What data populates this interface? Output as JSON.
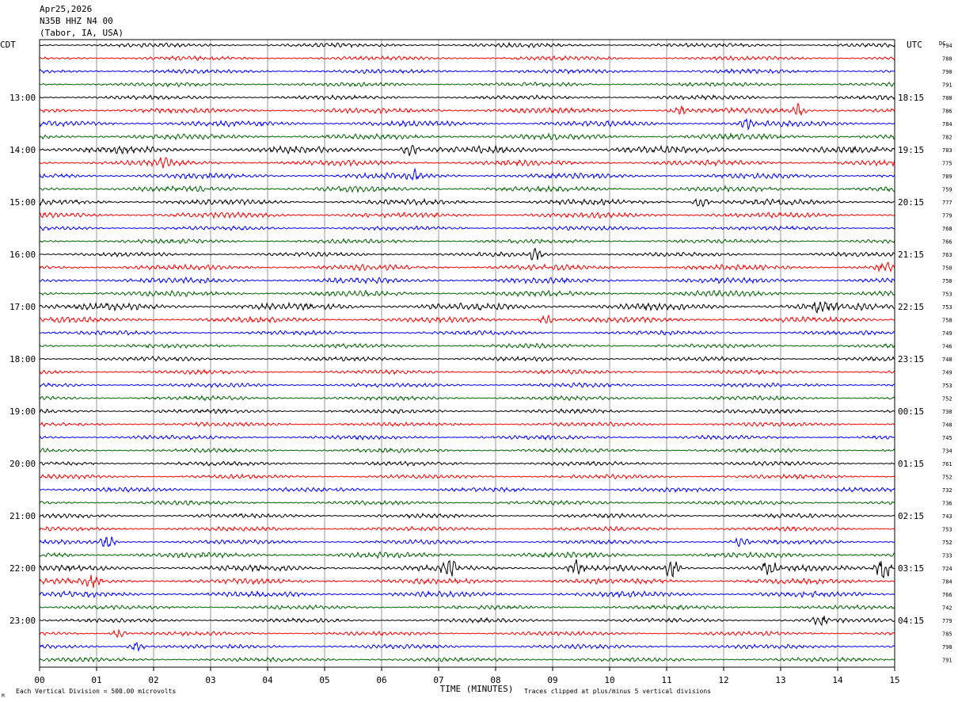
{
  "header": {
    "date": "Apr25,2026",
    "station": "N35B HHZ N4 00",
    "location": "(Tabor, IA, USA)"
  },
  "left_tz_label": "CDT",
  "right_tz_label": "UTC",
  "dc_label": "DC",
  "footer": {
    "xlabel": "TIME (MINUTES)",
    "scale_note": "Each Vertical Division =  500.00 microvolts",
    "clip_note": "Traces clipped at plus/minus 5 vertical divisions",
    "corner_mark": "M"
  },
  "chart_data": {
    "type": "line",
    "title": "N35B HHZ N4 00 (Tabor, IA, USA) Apr25,2026",
    "xlabel": "TIME (MINUTES)",
    "xlim": [
      0,
      15
    ],
    "x_ticks": [
      "00",
      "01",
      "02",
      "03",
      "04",
      "05",
      "06",
      "07",
      "08",
      "09",
      "10",
      "11",
      "12",
      "13",
      "14",
      "15"
    ],
    "trace_colors": [
      "#000000",
      "#ff0000",
      "#0000ff",
      "#006400"
    ],
    "left_time_labels": [
      {
        "trace": 4,
        "label": "13:00"
      },
      {
        "trace": 8,
        "label": "14:00"
      },
      {
        "trace": 12,
        "label": "15:00"
      },
      {
        "trace": 16,
        "label": "16:00"
      },
      {
        "trace": 20,
        "label": "17:00"
      },
      {
        "trace": 24,
        "label": "18:00"
      },
      {
        "trace": 28,
        "label": "19:00"
      },
      {
        "trace": 32,
        "label": "20:00"
      },
      {
        "trace": 36,
        "label": "21:00"
      },
      {
        "trace": 40,
        "label": "22:00"
      },
      {
        "trace": 44,
        "label": "23:00"
      }
    ],
    "right_time_labels": [
      {
        "trace": 4,
        "label": "18:15"
      },
      {
        "trace": 8,
        "label": "19:15"
      },
      {
        "trace": 12,
        "label": "20:15"
      },
      {
        "trace": 16,
        "label": "21:15"
      },
      {
        "trace": 20,
        "label": "22:15"
      },
      {
        "trace": 24,
        "label": "23:15"
      },
      {
        "trace": 28,
        "label": "00:15"
      },
      {
        "trace": 32,
        "label": "01:15"
      },
      {
        "trace": 36,
        "label": "02:15"
      },
      {
        "trace": 40,
        "label": "03:15"
      },
      {
        "trace": 44,
        "label": "04:15"
      }
    ],
    "dc_offsets": [
      794,
      788,
      790,
      791,
      788,
      786,
      784,
      782,
      783,
      775,
      789,
      759,
      777,
      779,
      768,
      766,
      763,
      750,
      750,
      753,
      753,
      758,
      749,
      746,
      748,
      749,
      753,
      752,
      730,
      748,
      745,
      734,
      761,
      752,
      732,
      736,
      743,
      753,
      752,
      733,
      724,
      784,
      766,
      742,
      779,
      785,
      790,
      791
    ],
    "trace_amplitude": [
      3,
      3,
      3,
      3,
      3,
      4,
      4,
      4,
      5,
      4,
      4,
      4,
      4,
      4,
      3,
      3,
      3,
      4,
      4,
      4,
      5,
      4,
      3,
      3,
      3,
      3,
      3,
      3,
      3,
      3,
      3,
      3,
      3,
      3,
      3,
      3,
      3,
      3,
      3,
      4,
      4,
      4,
      4,
      3,
      3,
      3,
      3,
      3
    ],
    "events": [
      {
        "trace": 5,
        "x_min": 11.2,
        "amp": 8
      },
      {
        "trace": 5,
        "x_min": 13.3,
        "amp": 8
      },
      {
        "trace": 6,
        "x_min": 12.4,
        "amp": 8
      },
      {
        "trace": 8,
        "x_min": 6.5,
        "amp": 9
      },
      {
        "trace": 9,
        "x_min": 2.2,
        "amp": 7
      },
      {
        "trace": 10,
        "x_min": 6.6,
        "amp": 6
      },
      {
        "trace": 12,
        "x_min": 11.6,
        "amp": 8
      },
      {
        "trace": 16,
        "x_min": 8.7,
        "amp": 8
      },
      {
        "trace": 17,
        "x_min": 14.8,
        "amp": 9
      },
      {
        "trace": 20,
        "x_min": 13.7,
        "amp": 7
      },
      {
        "trace": 21,
        "x_min": 8.9,
        "amp": 7
      },
      {
        "trace": 38,
        "x_min": 1.2,
        "amp": 9
      },
      {
        "trace": 38,
        "x_min": 12.3,
        "amp": 7
      },
      {
        "trace": 40,
        "x_min": 7.2,
        "amp": 12
      },
      {
        "trace": 40,
        "x_min": 9.4,
        "amp": 10
      },
      {
        "trace": 40,
        "x_min": 11.1,
        "amp": 14
      },
      {
        "trace": 40,
        "x_min": 12.8,
        "amp": 11
      },
      {
        "trace": 40,
        "x_min": 14.8,
        "amp": 18
      },
      {
        "trace": 41,
        "x_min": 0.9,
        "amp": 8
      },
      {
        "trace": 44,
        "x_min": 13.7,
        "amp": 6
      },
      {
        "trace": 45,
        "x_min": 1.4,
        "amp": 6
      },
      {
        "trace": 46,
        "x_min": 1.7,
        "amp": 7
      }
    ]
  }
}
